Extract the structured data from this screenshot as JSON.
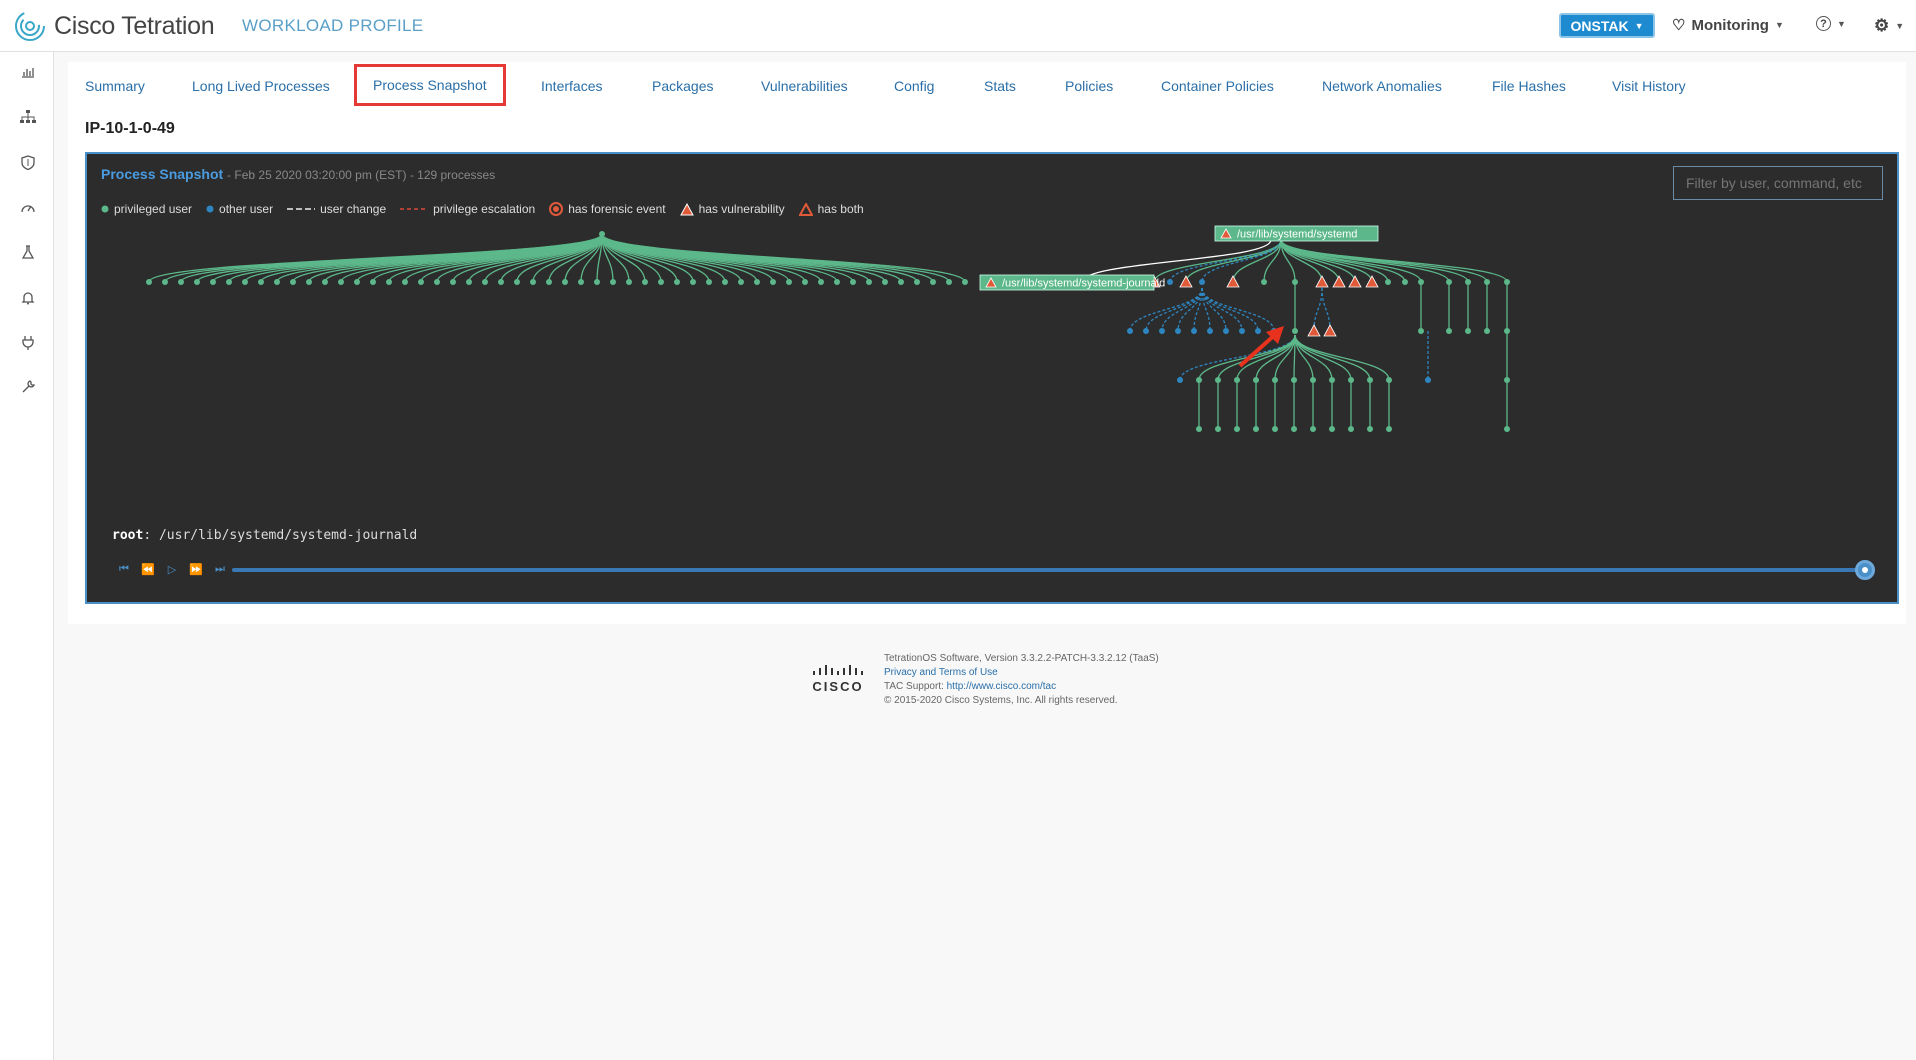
{
  "app": {
    "brand": "Cisco Tetration",
    "page_title": "WORKLOAD PROFILE"
  },
  "header": {
    "tenant": "ONSTAK",
    "monitoring": "Monitoring"
  },
  "tabs": [
    {
      "label": "Summary"
    },
    {
      "label": "Long Lived Processes"
    },
    {
      "label": "Process Snapshot"
    },
    {
      "label": "Interfaces"
    },
    {
      "label": "Packages"
    },
    {
      "label": "Vulnerabilities"
    },
    {
      "label": "Config"
    },
    {
      "label": "Stats"
    },
    {
      "label": "Policies"
    },
    {
      "label": "Container Policies"
    },
    {
      "label": "Network Anomalies"
    },
    {
      "label": "File Hashes"
    },
    {
      "label": "Visit History"
    }
  ],
  "host": "IP-10-1-0-49",
  "snapshot": {
    "title": "Process Snapshot",
    "meta": "- Feb 25 2020 03:20:00 pm (EST) - 129 processes",
    "filter_placeholder": "Filter by user, command, etc",
    "legend": {
      "privileged": "privileged user",
      "other": "other user",
      "user_change": "user change",
      "priv_escalation": "privilege escalation",
      "forensic": "has forensic event",
      "vulnerability": "has vulnerability",
      "both": "has both"
    },
    "node_systemd": "/usr/lib/systemd/systemd",
    "node_journald": "/usr/lib/systemd/systemd-journald",
    "status_user": "root",
    "status_cmd": "/usr/lib/systemd/systemd-journald",
    "colors": {
      "privileged": "#5cb88a",
      "other": "#2e86c1",
      "vuln": "#e05a3a"
    }
  },
  "footer": {
    "version": "TetrationOS Software, Version 3.3.2.2-PATCH-3.3.2.12 (TaaS)",
    "privacy": "Privacy and Terms of Use",
    "tac_label": "TAC Support:",
    "tac_link": "http://www.cisco.com/tac",
    "copyright": "© 2015-2020 Cisco Systems, Inc. All rights reserved.",
    "logo_word": "CISCO"
  }
}
